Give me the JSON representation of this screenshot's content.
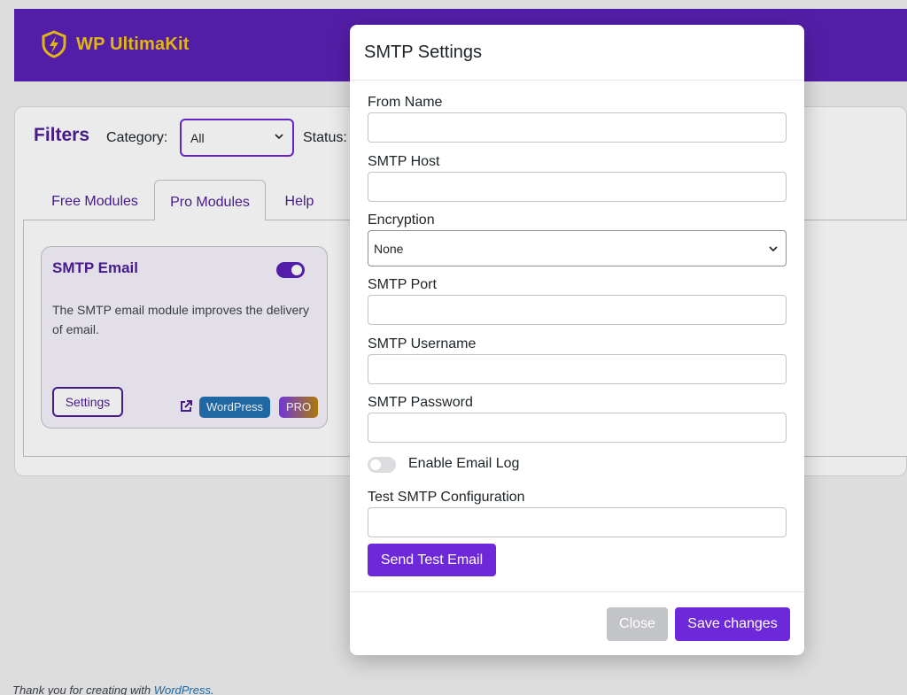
{
  "brand": {
    "name": "WP UltimaKit",
    "logo_icon": "shield-bolt-icon",
    "color": "#f5c518"
  },
  "filters": {
    "title": "Filters",
    "category_label": "Category:",
    "category_value": "All",
    "status_label": "Status:"
  },
  "tabs": [
    {
      "label": "Free Modules",
      "active": false
    },
    {
      "label": "Pro Modules",
      "active": true
    },
    {
      "label": "Help",
      "active": false
    }
  ],
  "module": {
    "title": "SMTP Email",
    "enabled": true,
    "description": "The SMTP email module improves the delivery of email.",
    "settings_label": "Settings",
    "external_icon": "external-link-icon",
    "badges": [
      "WordPress",
      "PRO"
    ]
  },
  "footer": {
    "text": "Thank you for creating with",
    "link": "WordPress",
    "punct": "."
  },
  "modal": {
    "title": "SMTP Settings",
    "fields": {
      "from_name": {
        "label": "From Name",
        "value": ""
      },
      "smtp_host": {
        "label": "SMTP Host",
        "value": ""
      },
      "encryption": {
        "label": "Encryption",
        "value": "None"
      },
      "smtp_port": {
        "label": "SMTP Port",
        "value": ""
      },
      "smtp_username": {
        "label": "SMTP Username",
        "value": ""
      },
      "smtp_password": {
        "label": "SMTP Password",
        "value": ""
      },
      "test_config": {
        "label": "Test SMTP Configuration",
        "value": ""
      }
    },
    "email_log": {
      "label": "Enable Email Log",
      "enabled": false
    },
    "send_test_label": "Send Test Email",
    "close_label": "Close",
    "save_label": "Save changes"
  },
  "colors": {
    "accent": "#6d28d9",
    "header_bg": "#5b21b6",
    "badge_wordpress": "#2271b1"
  }
}
